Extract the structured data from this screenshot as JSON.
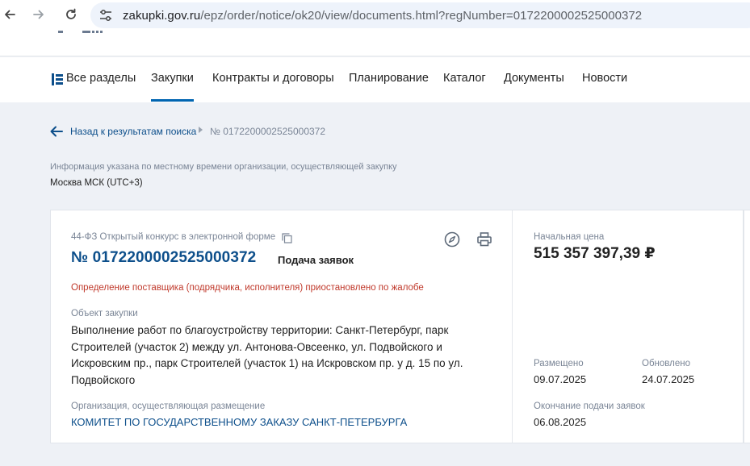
{
  "browser": {
    "url_host": "zakupki.gov.ru",
    "url_path": "/epz/order/notice/ok20/view/documents.html?regNumber=0172200002525000372"
  },
  "nav": {
    "items": [
      {
        "label": "Все разделы"
      },
      {
        "label": "Закупки",
        "active": true
      },
      {
        "label": "Контракты и договоры"
      },
      {
        "label": "Планирование"
      },
      {
        "label": "Каталог"
      },
      {
        "label": "Документы"
      },
      {
        "label": "Новости"
      }
    ]
  },
  "breadcrumb": {
    "back_label": "Назад к результатам поиска",
    "current": "№ 0172200002525000372"
  },
  "timezone": {
    "note": "Информация указана по местному времени организации, осуществляющей закупку",
    "value": "Москва МСК (UTC+3)"
  },
  "notice": {
    "law_and_type": "44-ФЗ Открытый конкурс в электронной форме",
    "number": "№ 0172200002525000372",
    "stage": "Подача заявок",
    "suspension": "Определение поставщика (подрядчика, исполнителя) приостановлено по жалобе",
    "object_label": "Объект закупки",
    "object_lines": [
      "Выполнение работ по благоустройству территории: Санкт-Петербург, парк",
      "Строителей (участок 2) между ул. Антонова-Овсеенко, ул. Подвойского и",
      "Искровским пр., парк Строителей (участок 1) на Искровском пр. у д. 15 по ул.",
      "Подвойского"
    ],
    "org_label": "Организация, осуществляющая размещение",
    "org_name": "КОМИТЕТ ПО ГОСУДАРСТВЕННОМУ ЗАКАЗУ САНКТ-ПЕТЕРБУРГА"
  },
  "summary": {
    "price_label": "Начальная цена",
    "price": "515 357 397,39 ₽",
    "posted_label": "Размещено",
    "posted": "09.07.2025",
    "updated_label": "Обновлено",
    "updated": "24.07.2025",
    "deadline_label": "Окончание подачи заявок",
    "deadline": "06.08.2025"
  },
  "colors": {
    "link": "#0d4f8b",
    "accent": "#0065b1",
    "warning": "#c0392b",
    "muted": "#7a8596"
  },
  "icons": [
    "back-arrow-icon",
    "forward-arrow-icon",
    "reload-icon",
    "site-settings-icon",
    "sections-grid-icon",
    "back-arrow-blue-icon",
    "copy-icon",
    "compass-icon",
    "print-icon"
  ]
}
